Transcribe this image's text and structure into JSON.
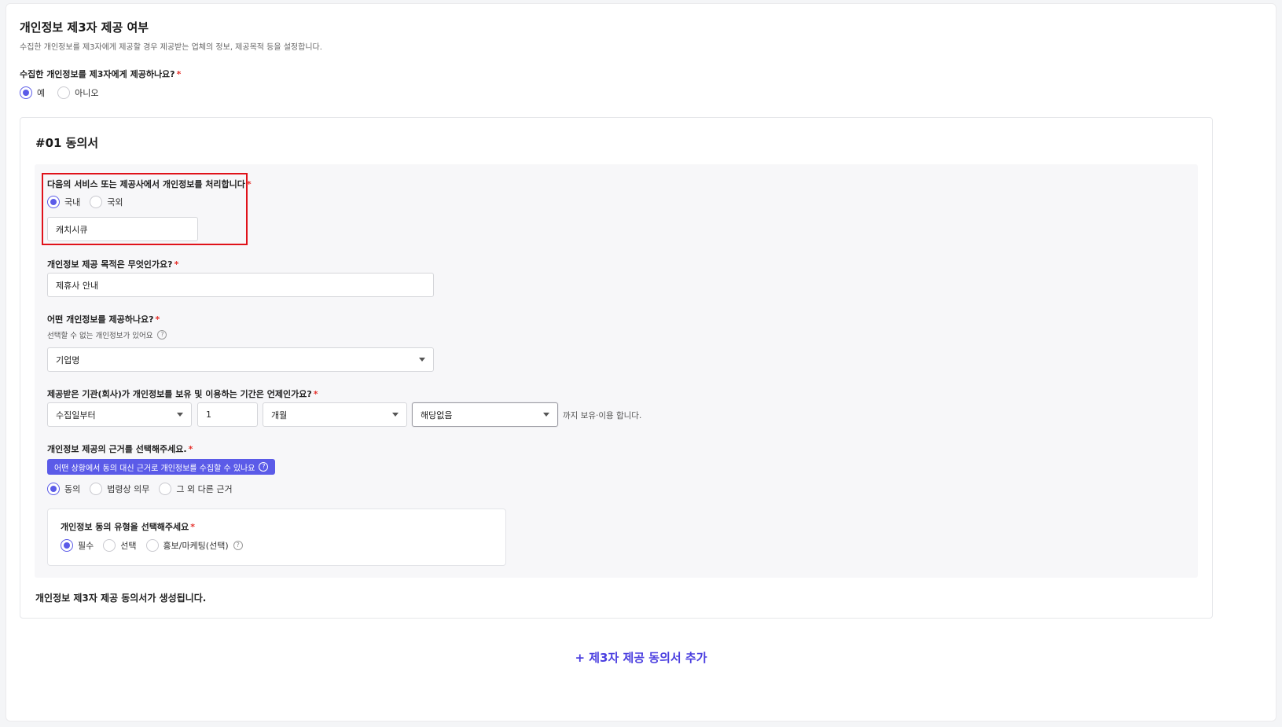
{
  "section": {
    "title": "개인정보 제3자 제공 여부",
    "description": "수집한 개인정보를 제3자에게 제공할 경우 제공받는 업체의 정보, 제공목적 등을 설정합니다.",
    "question": "수집한 개인정보를 제3자에게 제공하나요?",
    "required": "*",
    "options": [
      "예",
      "아니오"
    ],
    "selected": "예"
  },
  "consent": {
    "title": "#01 동의서",
    "processor": {
      "label": "다음의 서비스 또는 제공사에서 개인정보를 처리합니다",
      "required": "*",
      "options": [
        "국내",
        "국외"
      ],
      "selected": "국내",
      "value": "캐치시큐"
    },
    "purpose": {
      "label": "개인정보 제공 목적은 무엇인가요?",
      "required": "*",
      "value": "제휴사 안내"
    },
    "items": {
      "label": "어떤 개인정보를 제공하나요?",
      "required": "*",
      "sub_label": "선택할 수 없는 개인정보가 있어요",
      "help_icon": "?",
      "value": "기업명"
    },
    "retention": {
      "label": "제공받은 기관(회사)가 개인정보를 보유 및 이용하는 기간은 언제인가요?",
      "required": "*",
      "from": "수집일부터",
      "amount": "1",
      "unit": "개월",
      "extra": "해당없음",
      "suffix": "까지 보유·이용 합니다."
    },
    "basis": {
      "label": "개인정보 제공의 근거를 선택해주세요.",
      "required": "*",
      "hint_button": "어떤 상황에서 동의 대신 근거로 개인정보를 수집할 수 있나요",
      "help_icon": "?",
      "options": [
        "동의",
        "법령상 의무",
        "그 외 다른 근거"
      ],
      "selected": "동의"
    },
    "consent_type": {
      "label": "개인정보 동의 유형을 선택해주세요",
      "required": "*",
      "options": [
        "필수",
        "선택",
        "홍보/마케팅(선택)"
      ],
      "selected": "필수",
      "help_icon": "?"
    },
    "footer_note": "개인정보 제3자 제공 동의서가 생성됩니다."
  },
  "add_button": "+ 제3자 제공 동의서 추가",
  "colors": {
    "accent": "#5b5be8",
    "highlight_box": "#e0121a",
    "link": "#4b3fe0"
  }
}
